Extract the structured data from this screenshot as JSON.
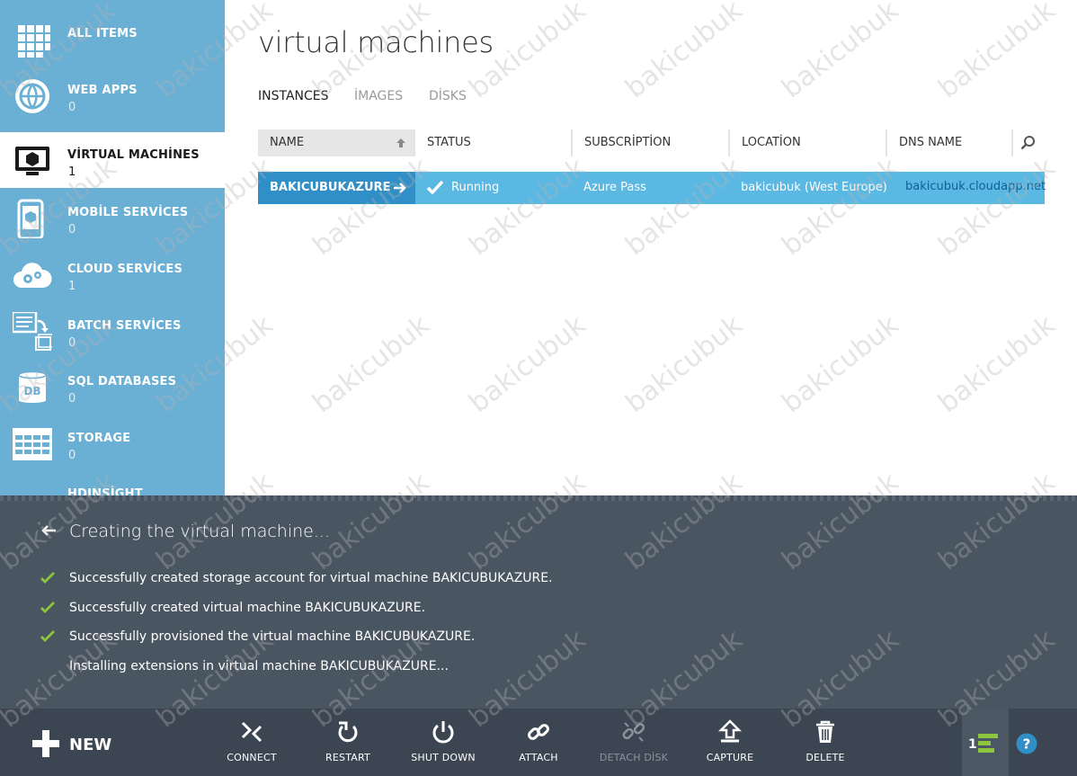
{
  "sidebar": {
    "items": [
      {
        "label": "ALL ITEMS",
        "count": "",
        "icon": "grid-icon"
      },
      {
        "label": "WEB APPS",
        "count": "0",
        "icon": "globe-icon"
      },
      {
        "label": "VİRTUAL MACHİNES",
        "count": "1",
        "icon": "monitor-icon",
        "active": true
      },
      {
        "label": "MOBİLE SERVİCES",
        "count": "0",
        "icon": "phone-icon"
      },
      {
        "label": "CLOUD SERVİCES",
        "count": "1",
        "icon": "cloud-gears-icon"
      },
      {
        "label": "BATCH SERVİCES",
        "count": "0",
        "icon": "batch-icon"
      },
      {
        "label": "SQL DATABASES",
        "count": "0",
        "icon": "database-icon"
      },
      {
        "label": "STORAGE",
        "count": "0",
        "icon": "table-icon"
      },
      {
        "label": "HDINSİGHT",
        "count": "",
        "icon": "elephant-icon"
      }
    ]
  },
  "main": {
    "title": "virtual machines",
    "tabs": [
      {
        "label": "INSTANCES",
        "active": true
      },
      {
        "label": "İMAGES"
      },
      {
        "label": "DİSKS"
      }
    ],
    "columns": [
      "NAME",
      "STATUS",
      "SUBSCRİPTİON",
      "LOCATİON",
      "DNS NAME"
    ],
    "rows": [
      {
        "name": "BAKICUBUKAZURE",
        "status": "Running",
        "subscription": "Azure Pass",
        "location": "bakicubuk (West Europe)",
        "dns": "bakicubuk.cloudapp.net"
      }
    ]
  },
  "notification": {
    "title": "Creating the virtual machine...",
    "items": [
      {
        "text": "Successfully created storage account for virtual machine BAKICUBUKAZURE.",
        "done": true
      },
      {
        "text": "Successfully created virtual machine BAKICUBUKAZURE.",
        "done": true
      },
      {
        "text": "Successfully provisioned the virtual machine BAKICUBUKAZURE.",
        "done": true
      },
      {
        "text": "Installing extensions in virtual machine BAKICUBUKAZURE...",
        "done": false
      }
    ]
  },
  "commandbar": {
    "new_label": "NEW",
    "commands": [
      {
        "label": "CONNECT",
        "icon": "connect-icon"
      },
      {
        "label": "RESTART",
        "icon": "restart-icon"
      },
      {
        "label": "SHUT DOWN",
        "icon": "power-icon"
      },
      {
        "label": "ATTACH",
        "icon": "link-icon"
      },
      {
        "label": "DETACH DİSK",
        "icon": "broken-link-icon",
        "disabled": true
      },
      {
        "label": "CAPTURE",
        "icon": "capture-icon"
      },
      {
        "label": "DELETE",
        "icon": "trash-icon"
      }
    ],
    "progress_count": "1"
  },
  "watermark": "bakicubuk",
  "colors": {
    "sidebar": "#6aafd4",
    "selected_row": "#5bb8e2",
    "selected_name": "#2f8fc6",
    "panel": "#4a5562",
    "cmdbar": "#3c4653",
    "check": "#8cc63f"
  }
}
